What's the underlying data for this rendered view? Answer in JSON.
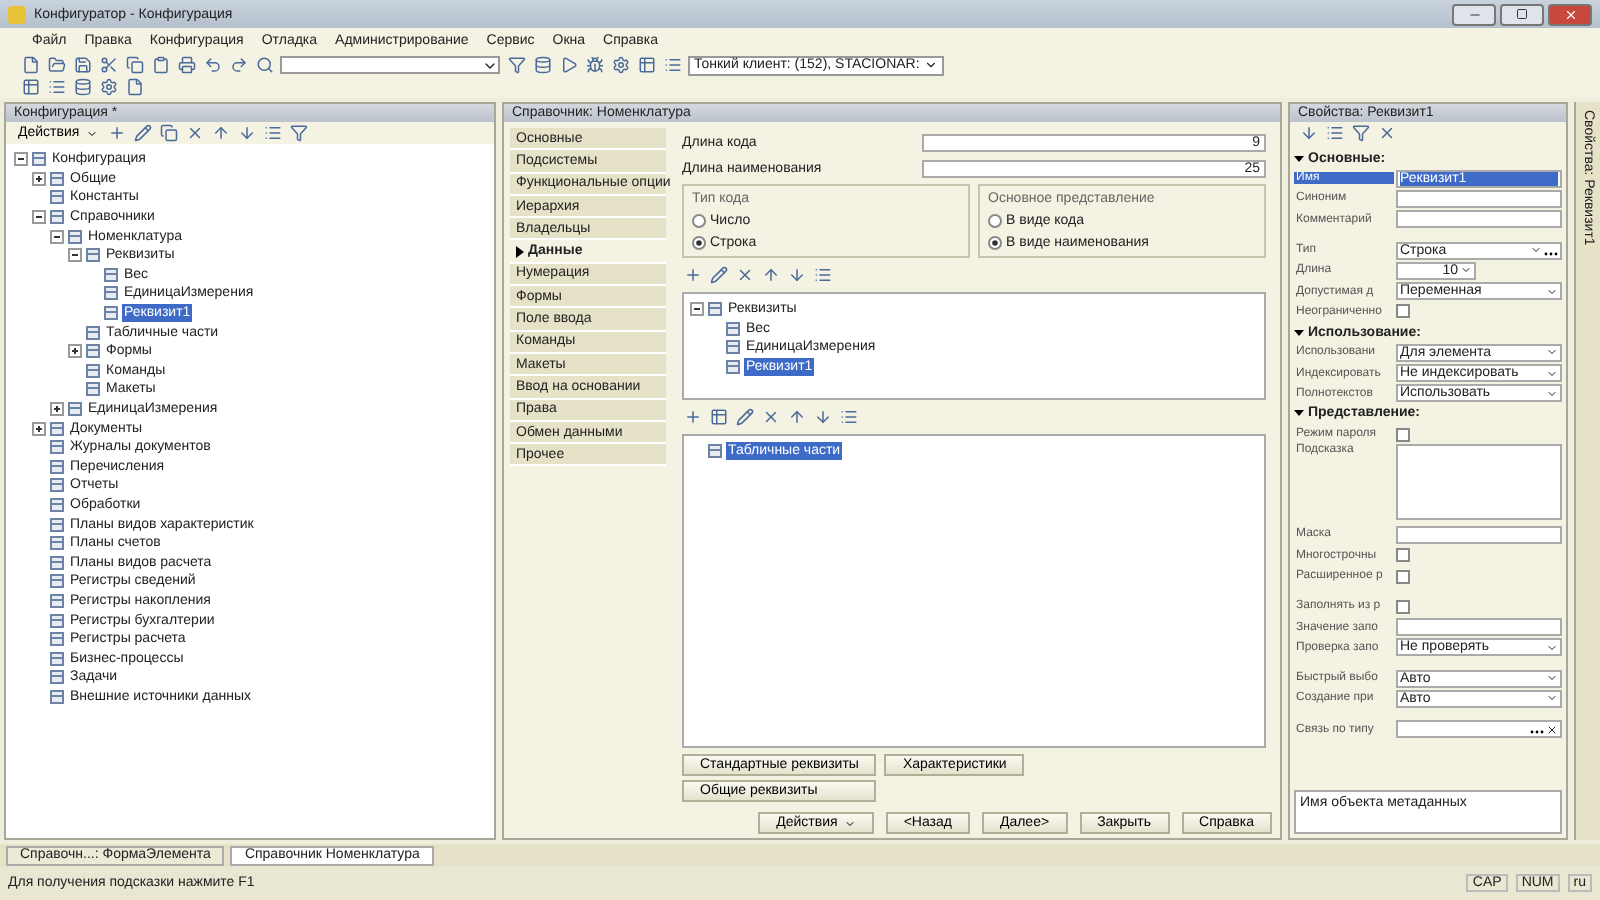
{
  "window": {
    "title": "Конфигуратор - Конфигурация"
  },
  "menu": [
    "Файл",
    "Правка",
    "Конфигурация",
    "Отладка",
    "Администрирование",
    "Сервис",
    "Окна",
    "Справка"
  ],
  "toolbar": {
    "client_select": "Тонкий клиент: (152), STACIONAR:"
  },
  "config_panel": {
    "title": "Конфигурация *",
    "actions": "Действия",
    "tree": [
      {
        "label": "Конфигурация",
        "expanded": true,
        "selected": false,
        "children": [
          {
            "label": "Общие",
            "expanded": false,
            "selected": false
          },
          {
            "label": "Константы",
            "selected": false
          },
          {
            "label": "Справочники",
            "expanded": true,
            "selected": false,
            "children": [
              {
                "label": "Номенклатура",
                "expanded": true,
                "selected": false,
                "children": [
                  {
                    "label": "Реквизиты",
                    "expanded": true,
                    "selected": false,
                    "children": [
                      {
                        "label": "Вес",
                        "selected": false
                      },
                      {
                        "label": "ЕдиницаИзмерения",
                        "selected": false
                      },
                      {
                        "label": "Реквизит1",
                        "selected": true
                      }
                    ]
                  },
                  {
                    "label": "Табличные части",
                    "selected": false
                  },
                  {
                    "label": "Формы",
                    "expanded": false,
                    "selected": false
                  },
                  {
                    "label": "Команды",
                    "selected": false
                  },
                  {
                    "label": "Макеты",
                    "selected": false
                  }
                ]
              },
              {
                "label": "ЕдиницаИзмерения",
                "expanded": false,
                "selected": false
              }
            ]
          },
          {
            "label": "Документы",
            "expanded": false,
            "selected": false
          },
          {
            "label": "Журналы документов",
            "selected": false
          },
          {
            "label": "Перечисления",
            "selected": false
          },
          {
            "label": "Отчеты",
            "selected": false
          },
          {
            "label": "Обработки",
            "selected": false
          },
          {
            "label": "Планы видов характеристик",
            "selected": false
          },
          {
            "label": "Планы счетов",
            "selected": false
          },
          {
            "label": "Планы видов расчета",
            "selected": false
          },
          {
            "label": "Регистры сведений",
            "selected": false
          },
          {
            "label": "Регистры накопления",
            "selected": false
          },
          {
            "label": "Регистры бухгалтерии",
            "selected": false
          },
          {
            "label": "Регистры расчета",
            "selected": false
          },
          {
            "label": "Бизнес-процессы",
            "selected": false
          },
          {
            "label": "Задачи",
            "selected": false
          },
          {
            "label": "Внешние источники данных",
            "selected": false
          }
        ]
      }
    ]
  },
  "editor": {
    "title": "Справочник: Номенклатура",
    "nav": [
      {
        "label": "Основные",
        "selected": false
      },
      {
        "label": "Подсистемы",
        "selected": false
      },
      {
        "label": "Функциональные опции",
        "selected": false
      },
      {
        "label": "Иерархия",
        "selected": false
      },
      {
        "label": "Владельцы",
        "selected": false
      },
      {
        "label": "Данные",
        "selected": true
      },
      {
        "label": "Нумерация",
        "selected": false
      },
      {
        "label": "Формы",
        "selected": false
      },
      {
        "label": "Поле ввода",
        "selected": false
      },
      {
        "label": "Команды",
        "selected": false
      },
      {
        "label": "Макеты",
        "selected": false
      },
      {
        "label": "Ввод на основании",
        "selected": false
      },
      {
        "label": "Права",
        "selected": false
      },
      {
        "label": "Обмен данными",
        "selected": false
      },
      {
        "label": "Прочее",
        "selected": false
      }
    ],
    "fields": [
      {
        "label": "Длина кода",
        "value": "9"
      },
      {
        "label": "Длина наименования",
        "value": "25"
      }
    ],
    "groups": [
      {
        "title": "Тип кода",
        "options": [
          {
            "label": "Число",
            "selected": false
          },
          {
            "label": "Строка",
            "selected": true
          }
        ]
      },
      {
        "title": "Основное представление",
        "options": [
          {
            "label": "В виде кода",
            "selected": false
          },
          {
            "label": "В виде наименования",
            "selected": true
          }
        ]
      }
    ],
    "attributes": [
      {
        "label": "Реквизиты",
        "expanded": true,
        "selected": false,
        "children": [
          {
            "label": "Вес",
            "selected": false
          },
          {
            "label": "ЕдиницаИзмерения",
            "selected": false
          },
          {
            "label": "Реквизит1",
            "selected": true
          }
        ]
      }
    ],
    "tabular": [
      {
        "label": "Табличные части",
        "selected": true
      }
    ],
    "side_buttons": [
      "Стандартные реквизиты",
      "Характеристики",
      "Общие реквизиты"
    ],
    "footer_buttons": [
      {
        "label": "Действия",
        "kind": "menu"
      },
      {
        "label": "<Назад",
        "kind": "plain"
      },
      {
        "label": "Далее>",
        "kind": "plain"
      },
      {
        "label": "Закрыть",
        "kind": "plain"
      },
      {
        "label": "Справка",
        "kind": "plain"
      }
    ]
  },
  "properties": {
    "title": "Свойства: Реквизит1",
    "footer": "Имя объекта метаданных",
    "sections": [
      {
        "title": "Основные:",
        "expanded": true,
        "rows": [
          {
            "kind": "text",
            "label": "Имя",
            "value": "Реквизит1",
            "selected": true
          },
          {
            "kind": "text",
            "label": "Синоним",
            "selected": false
          },
          {
            "kind": "text",
            "label": "Комментарий",
            "selected": false
          },
          {
            "kind": "gap"
          },
          {
            "kind": "select",
            "label": "Тип",
            "value": "Строка",
            "choice": true,
            "selected": false
          },
          {
            "kind": "number",
            "label": "Длина",
            "value": "10",
            "selected": false
          },
          {
            "kind": "select",
            "label": "Допустимая д",
            "value": "Переменная",
            "selected": false
          },
          {
            "kind": "checkbox",
            "label": "Неограниченно",
            "checked": false,
            "selected": false
          }
        ]
      },
      {
        "title": "Использование:",
        "expanded": true,
        "rows": [
          {
            "kind": "select",
            "label": "Использовани",
            "value": "Для элемента",
            "selected": false
          },
          {
            "kind": "select",
            "label": "Индексировать",
            "value": "Не индексировать",
            "selected": false
          },
          {
            "kind": "select",
            "label": "Полнотекстов",
            "value": "Использовать",
            "selected": false
          }
        ]
      },
      {
        "title": "Представление:",
        "expanded": true,
        "rows": [
          {
            "kind": "checkbox",
            "label": "Режим пароля",
            "checked": false,
            "selected": false
          },
          {
            "kind": "textarea",
            "label": "Подсказка",
            "selected": false
          },
          {
            "kind": "text",
            "label": "Маска",
            "selected": false
          },
          {
            "kind": "checkbox",
            "label": "Многострочны",
            "checked": false,
            "selected": false
          },
          {
            "kind": "checkbox",
            "label": "Расширенное р",
            "checked": false,
            "selected": false
          },
          {
            "kind": "gap"
          },
          {
            "kind": "checkbox",
            "label": "Заполнять из р",
            "checked": false,
            "selected": false
          },
          {
            "kind": "text",
            "label": "Значение запо",
            "selected": false
          },
          {
            "kind": "select",
            "label": "Проверка запо",
            "value": "Не проверять",
            "selected": false
          },
          {
            "kind": "gap"
          },
          {
            "kind": "select",
            "label": "Быстрый выбо",
            "value": "Авто",
            "selected": false
          },
          {
            "kind": "select",
            "label": "Создание при",
            "value": "Авто",
            "selected": false
          },
          {
            "kind": "gap"
          },
          {
            "kind": "link",
            "label": "Связь по типу",
            "selected": false
          }
        ]
      }
    ]
  },
  "side_tab": "Свойства: Реквизит1",
  "taskbar": [
    {
      "label": "Справочн...: ФормаЭлемента",
      "selected": false
    },
    {
      "label": "Справочник Номенклатура",
      "selected": true
    }
  ],
  "status_bar": {
    "hint": "Для получения подсказки нажмите F1",
    "indicators": [
      "CAP",
      "NUM",
      "ru"
    ]
  }
}
